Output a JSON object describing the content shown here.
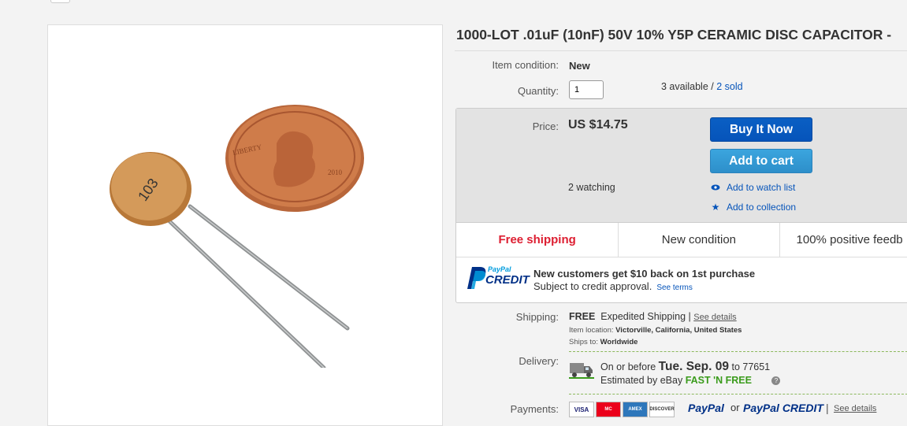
{
  "product": {
    "title": "1000-LOT .01uF (10nF) 50V 10% Y5P CERAMIC DISC CAPACITOR -",
    "image_alt": "103 ceramic disc capacitor next to penny"
  },
  "details": {
    "condition_label": "Item condition:",
    "condition_value": "New",
    "quantity_label": "Quantity:",
    "quantity_value": "1",
    "available_text": "3 available /",
    "sold_link": "2 sold"
  },
  "buybox": {
    "price_label": "Price:",
    "price_value": "US $14.75",
    "buy_now": "Buy It Now",
    "add_to_cart": "Add to cart",
    "watching": "2 watching",
    "add_watch": "Add to watch list",
    "add_collection": "Add to collection",
    "features": [
      "Free shipping",
      "New condition",
      "100% positive feedb"
    ],
    "credit_logo_top": "PayPal",
    "credit_logo_bottom": "CREDIT",
    "credit_headline": "New customers get $10 back on 1st purchase",
    "credit_sub": "Subject to credit approval.",
    "credit_terms": "See terms"
  },
  "shipping": {
    "label": "Shipping:",
    "free": "FREE",
    "method": "Expedited Shipping |",
    "see_details": "See details",
    "location_label": "Item location:",
    "location_value": "Victorville, California, United States",
    "ships_to_label": "Ships to:",
    "ships_to_value": "Worldwide"
  },
  "delivery": {
    "label": "Delivery:",
    "prefix": "On or before",
    "date": "Tue. Sep. 09",
    "to": "to 77651",
    "estimated": "Estimated by eBay",
    "fast": "FAST 'N FREE",
    "help": "?"
  },
  "payments": {
    "label": "Payments:",
    "cards": [
      "VISA",
      "MC",
      "AMEX",
      "DISCOVER"
    ],
    "paypal": "PayPal",
    "or": "or",
    "paypal_credit": "PayPal CREDIT",
    "sep": "|",
    "see_details": "See details"
  },
  "colors": {
    "link": "#0654ba",
    "buy_now": "#0654ba",
    "add_to_cart": "#2d8fca",
    "free_shipping": "#dd1e31",
    "fast_n_free": "#3a9b1b"
  }
}
